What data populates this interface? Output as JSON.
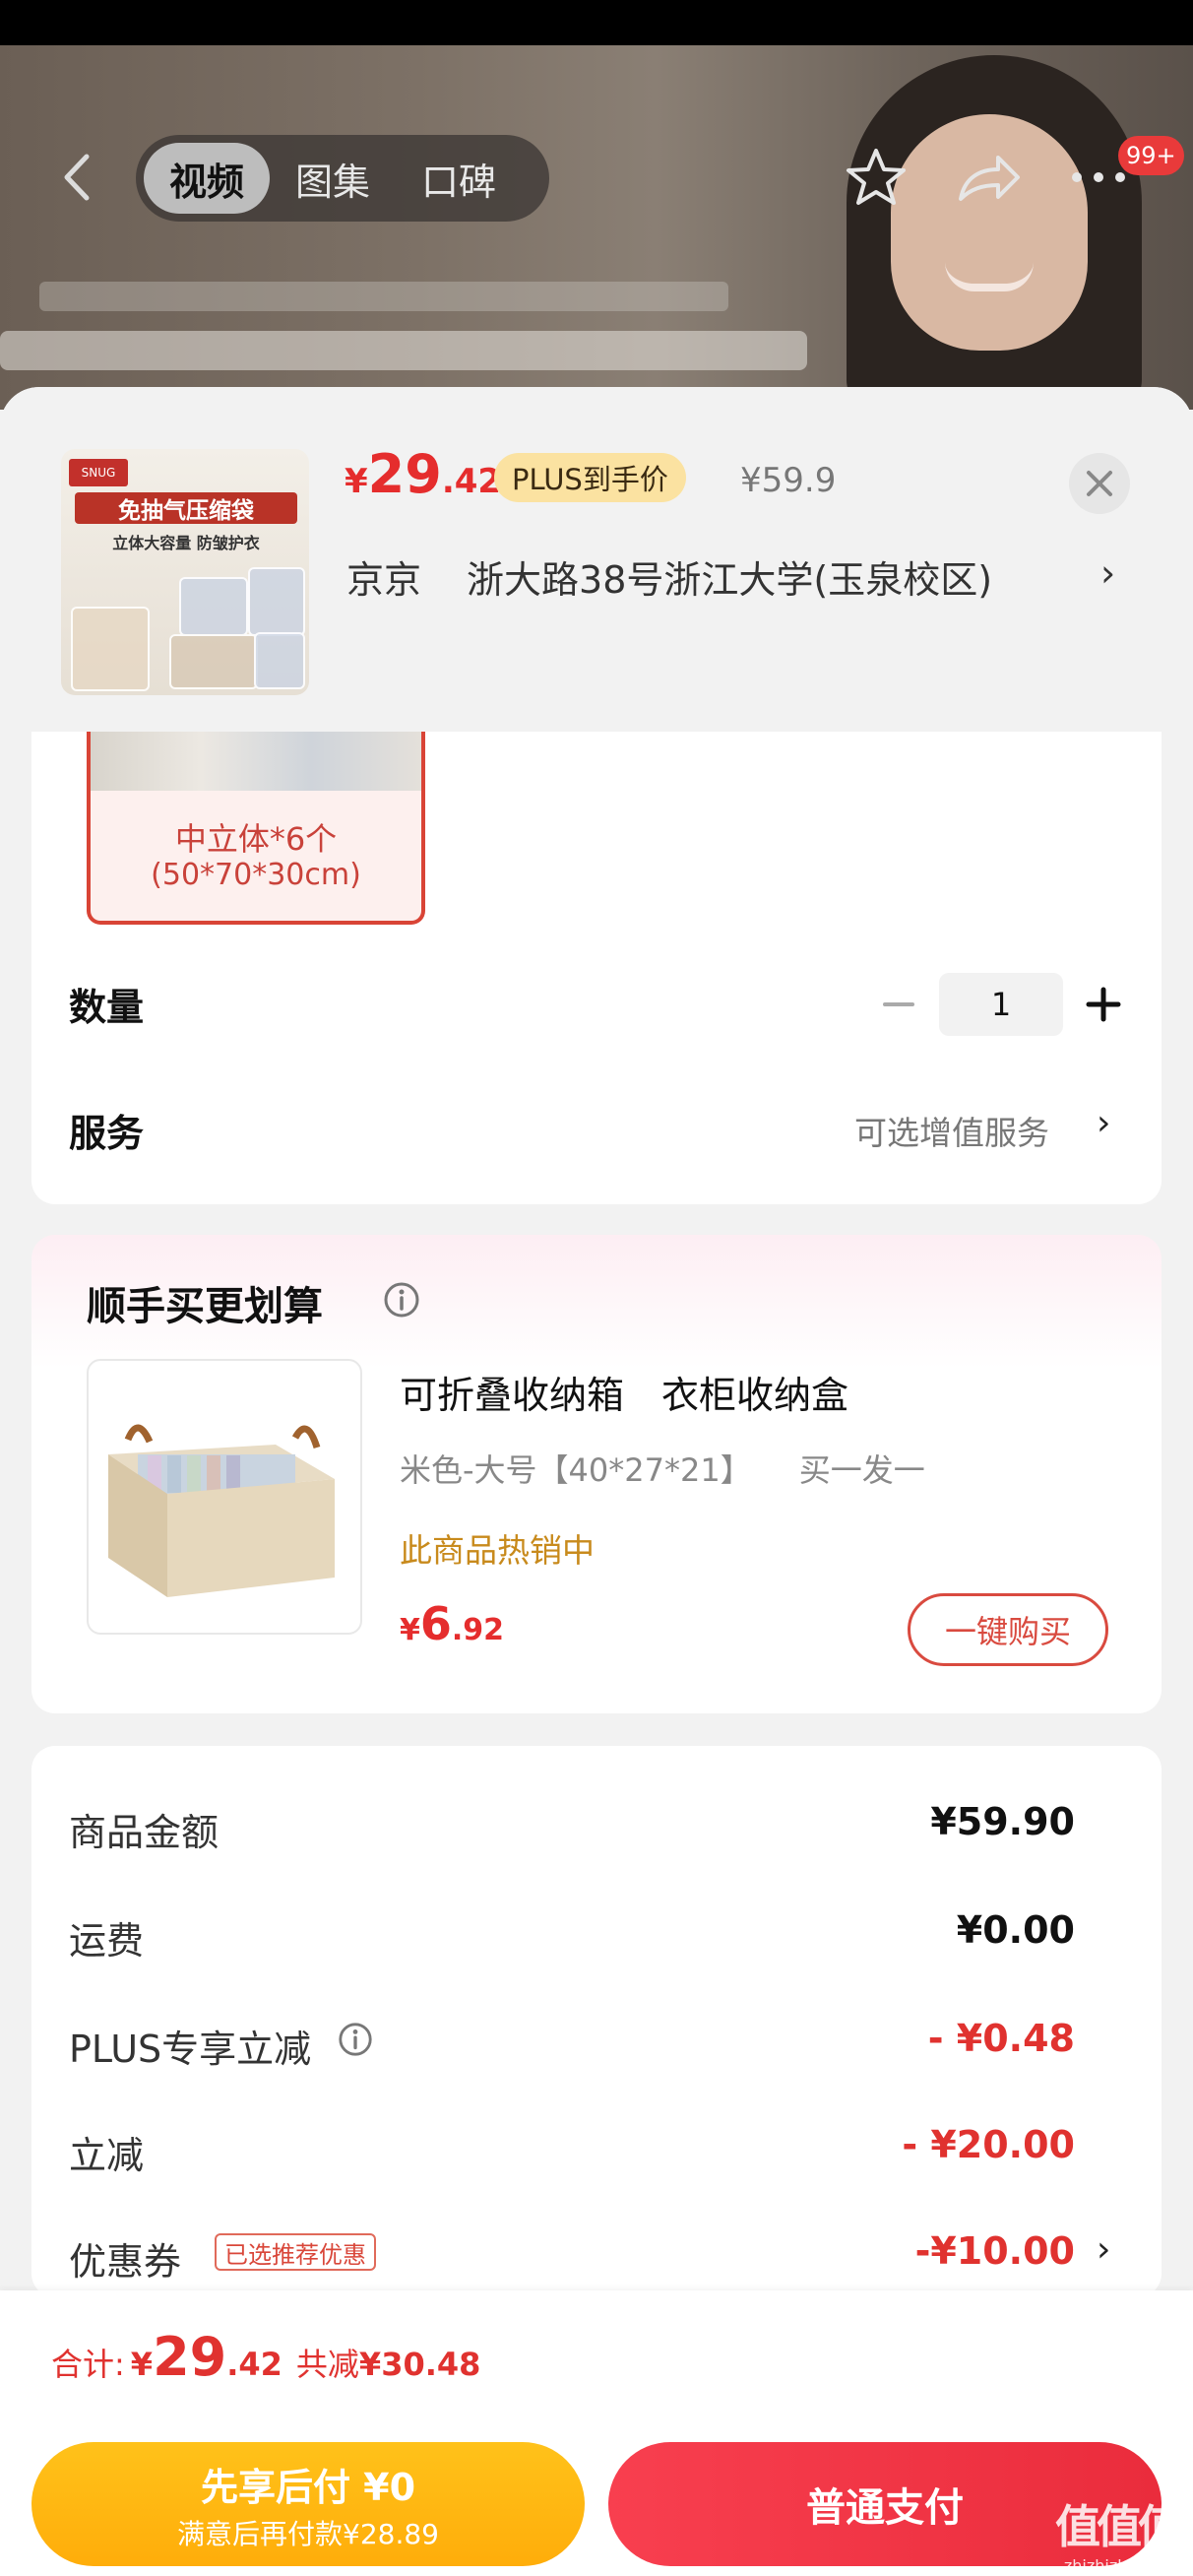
{
  "top_nav": {
    "tabs": [
      "视频",
      "图集",
      "口碑"
    ],
    "active_tab": 0,
    "badge": "99+"
  },
  "product": {
    "price_currency": "¥",
    "price_integer": "29",
    "price_decimal": ".42",
    "plus_tag": "PLUS到手价",
    "original_price": "¥59.9",
    "thumb_title": "免抽气压缩袋",
    "thumb_sub": "立体大容量 防皱护衣",
    "address_prefix": "京京",
    "address": "浙大路38号浙江大学(玉泉校区)",
    "address_chevron": "›"
  },
  "spec": {
    "name": "中立体*6个",
    "size": "(50*70*30cm)"
  },
  "quantity": {
    "label": "数量",
    "value": "1"
  },
  "service": {
    "label": "服务",
    "value": "可选增值服务",
    "chevron": "›"
  },
  "bundle": {
    "title": "顺手买更划算",
    "item_name": "可折叠收纳箱　衣柜收纳盒",
    "variant": "米色-大号【40*27*21】　　买一发一",
    "hot": "此商品热销中",
    "price_currency": "¥",
    "price_integer": "6",
    "price_decimal": ".92",
    "buy_button": "一键购买"
  },
  "summary": {
    "rows": [
      {
        "label": "商品金额",
        "value": "¥59.90"
      },
      {
        "label": "运费",
        "value": "¥0.00"
      },
      {
        "label": "PLUS专享立减",
        "value": "- ¥0.48"
      },
      {
        "label": "立减",
        "value": "- ¥20.00"
      },
      {
        "label": "优惠券",
        "value": "-¥10.00"
      }
    ],
    "coupon_tag": "已选推荐优惠",
    "coupon_chevron": "›"
  },
  "bottom": {
    "total_label": "合计:",
    "total_currency": "¥",
    "total_integer": "29",
    "total_decimal": ".42",
    "saved_label": "共减",
    "saved_value": "¥30.48",
    "paylater_title": "先享后付 ¥0",
    "paylater_sub": "满意后再付款¥28.89",
    "normal_pay": "普通支付"
  },
  "watermark": {
    "big": "值值值",
    "small": "zhizhizhi.com"
  },
  "colors": {
    "accent_red": "#e52d2d",
    "plus_gold": "#fbe2a1",
    "paylater_orange": "#ffad0a"
  }
}
